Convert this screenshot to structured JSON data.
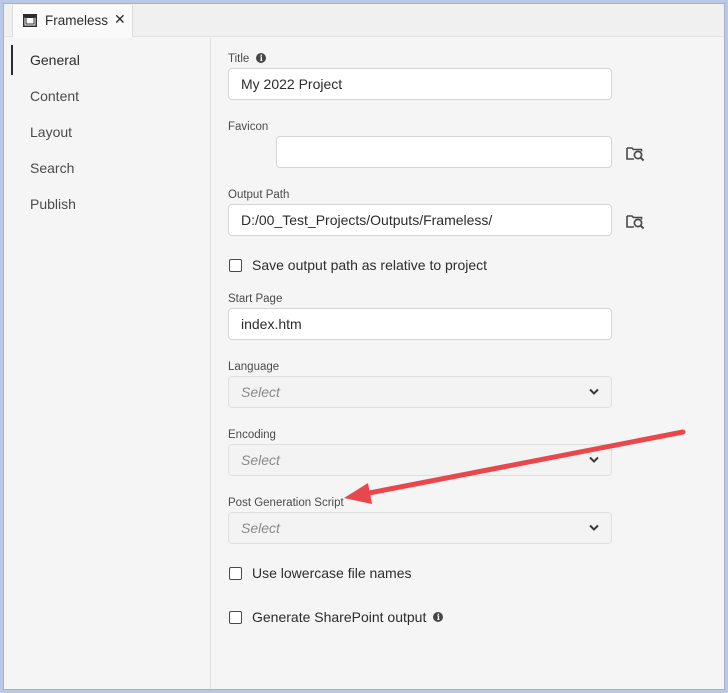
{
  "tab": {
    "label": "Frameless",
    "close": "✕"
  },
  "nav": {
    "items": [
      {
        "label": "General",
        "active": true
      },
      {
        "label": "Content"
      },
      {
        "label": "Layout"
      },
      {
        "label": "Search"
      },
      {
        "label": "Publish"
      }
    ]
  },
  "form": {
    "title": {
      "label": "Title",
      "value": "My 2022 Project"
    },
    "favicon": {
      "label": "Favicon",
      "value": ""
    },
    "output_path": {
      "label": "Output Path",
      "value": "D:/00_Test_Projects/Outputs/Frameless/"
    },
    "save_relative": {
      "label": "Save output path as relative to project",
      "checked": false
    },
    "start_page": {
      "label": "Start Page",
      "value": "index.htm"
    },
    "language": {
      "label": "Language",
      "placeholder": "Select"
    },
    "encoding": {
      "label": "Encoding",
      "placeholder": "Select"
    },
    "post_gen_script": {
      "label": "Post Generation Script",
      "placeholder": "Select"
    },
    "lowercase": {
      "label": "Use lowercase file names",
      "checked": false
    },
    "sharepoint": {
      "label": "Generate SharePoint output",
      "checked": false
    }
  },
  "annotation": {
    "arrow_color": "#e8474b"
  }
}
